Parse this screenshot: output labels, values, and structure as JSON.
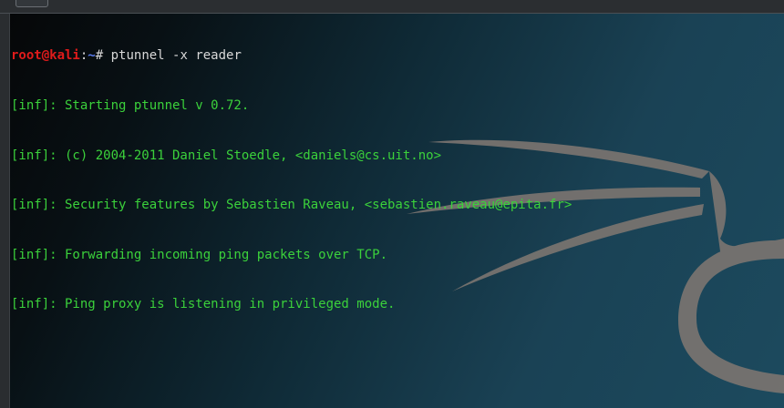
{
  "terminal": {
    "prompt": {
      "user_host": "root@kali",
      "separator": ":",
      "path": "~",
      "symbol": "#"
    },
    "command": " ptunnel -x reader",
    "output_lines": [
      "[inf]: Starting ptunnel v 0.72.",
      "[inf]: (c) 2004-2011 Daniel Stoedle, <daniels@cs.uit.no>",
      "[inf]: Security features by Sebastien Raveau, <sebastien.raveau@epita.fr>",
      "[inf]: Forwarding incoming ping packets over TCP.",
      "[inf]: Ping proxy is listening in privileged mode."
    ]
  },
  "wallpaper": {
    "icon": "kali-dragon-logo",
    "colors": {
      "background_dark": "#050607",
      "background_light": "#1c4a5e",
      "logo": "#7a7470"
    }
  },
  "colors": {
    "prompt_user": "#e01b1b",
    "prompt_path": "#5b7cf0",
    "command_text": "#d8d8d8",
    "output_text": "#3bd13b"
  }
}
